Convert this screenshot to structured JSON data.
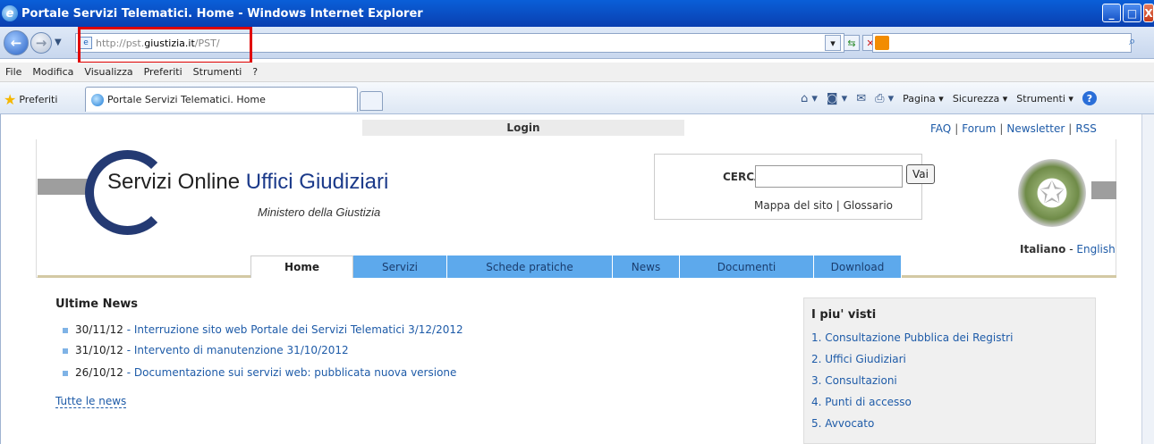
{
  "window": {
    "title": "Portale Servizi Telematici. Home - Windows Internet Explorer"
  },
  "address": {
    "url_prefix": "http://pst.",
    "url_host": "giustizia.it",
    "url_path": "/PST/"
  },
  "menu": [
    "File",
    "Modifica",
    "Visualizza",
    "Preferiti",
    "Strumenti",
    "?"
  ],
  "favorites": {
    "label": "Preferiti",
    "tab_title": "Portale Servizi Telematici. Home"
  },
  "commands": {
    "pagina": "Pagina",
    "sicurezza": "Sicurezza",
    "strumenti": "Strumenti"
  },
  "page": {
    "login": "Login",
    "toplinks": [
      "FAQ",
      "Forum",
      "Newsletter",
      "RSS"
    ],
    "logo": {
      "part1": "Servizi Online ",
      "part2": "Uffici Giudiziari",
      "sub": "Ministero della Giustizia"
    },
    "search": {
      "label": "CERCA",
      "button": "Vai",
      "mappa": "Mappa del sito",
      "glossario": "Glossario"
    },
    "lang": {
      "current": "Italiano",
      "sep": " - ",
      "other": "English"
    },
    "tabs": [
      "Home",
      "Servizi",
      "Schede pratiche",
      "News",
      "Documenti",
      "Download"
    ],
    "news": {
      "title": "Ultime News",
      "items": [
        {
          "date": "30/11/12",
          "text": "Interruzione sito web Portale dei Servizi Telematici 3/12/2012"
        },
        {
          "date": "31/10/12",
          "text": "Intervento di manutenzione 31/10/2012"
        },
        {
          "date": "26/10/12",
          "text": "Documentazione sui servizi web: pubblicata nuova versione"
        }
      ],
      "all": "Tutte le news"
    },
    "piu_visti": {
      "title": "I piu' visti",
      "items": [
        "1. Consultazione Pubblica dei Registri",
        "2. Uffici Giudiziari",
        "3. Consultazioni",
        "4. Punti di accesso",
        "5. Avvocato"
      ]
    }
  }
}
